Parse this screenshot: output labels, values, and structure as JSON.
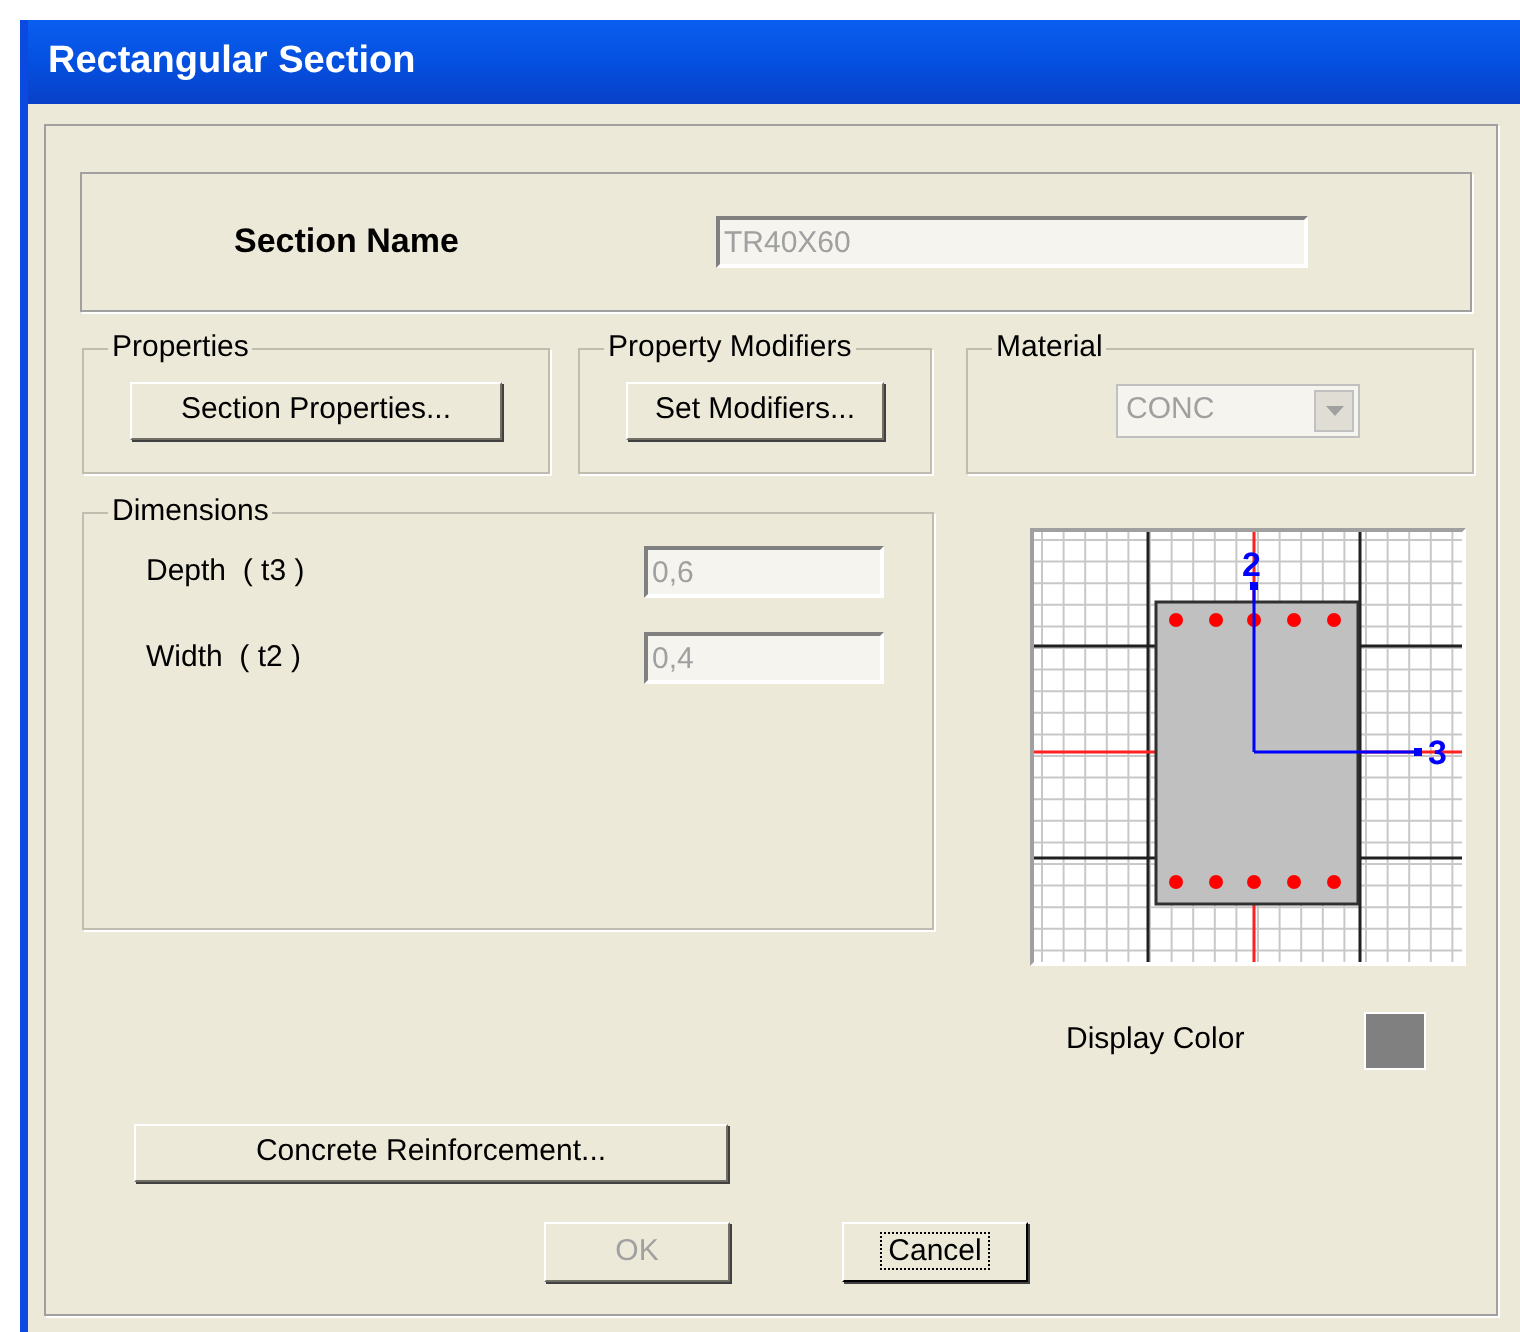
{
  "window": {
    "title": "Rectangular Section"
  },
  "section_name": {
    "label": "Section Name",
    "value": "TR40X60",
    "disabled": true
  },
  "properties": {
    "title": "Properties",
    "button": "Section Properties..."
  },
  "property_modifiers": {
    "title": "Property Modifiers",
    "button": "Set Modifiers..."
  },
  "material": {
    "title": "Material",
    "value": "CONC",
    "disabled": true
  },
  "dimensions": {
    "title": "Dimensions",
    "fields": [
      {
        "label": "Depth  ( t3 )",
        "value": "0,6",
        "disabled": true
      },
      {
        "label": "Width  ( t2 )",
        "value": "0,4",
        "disabled": true
      }
    ]
  },
  "diagram": {
    "axis_vertical": "2",
    "axis_horizontal": "3"
  },
  "display_color": {
    "label": "Display Color",
    "color": "#808080"
  },
  "concrete_reinforcement": {
    "label": "Concrete Reinforcement..."
  },
  "buttons": [
    {
      "label": "OK",
      "disabled": true,
      "focused": false
    },
    {
      "label": "Cancel",
      "disabled": false,
      "focused": true
    }
  ]
}
